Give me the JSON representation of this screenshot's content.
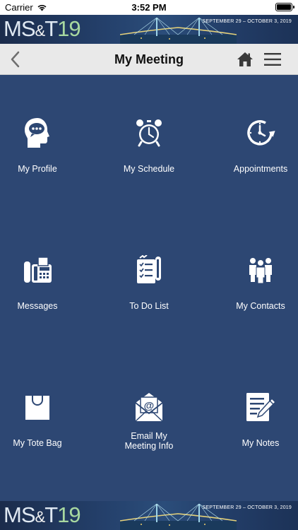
{
  "status_bar": {
    "carrier": "Carrier",
    "time": "3:52 PM"
  },
  "banner": {
    "title_ms": "MS",
    "title_amp": "&",
    "title_t": "T",
    "title_num": "19",
    "dates": "SEPTEMBER 29 – OCTOBER 3, 2019"
  },
  "navbar": {
    "title": "My Meeting",
    "back_icon": "chevron-left-icon",
    "home_icon": "home-icon",
    "menu_icon": "hamburger-menu-icon"
  },
  "tiles": [
    {
      "label": "My Profile",
      "icon": "profile-head-icon"
    },
    {
      "label": "My Schedule",
      "icon": "alarm-clock-icon"
    },
    {
      "label": "Appointments",
      "icon": "clock-arrow-icon"
    },
    {
      "label": "Messages",
      "icon": "fax-phone-icon"
    },
    {
      "label": "To Do List",
      "icon": "checklist-icon"
    },
    {
      "label": "My Contacts",
      "icon": "people-group-icon"
    },
    {
      "label": "My Tote Bag",
      "icon": "tote-bag-icon"
    },
    {
      "label": "Email My Meeting Info",
      "icon": "email-at-icon"
    },
    {
      "label": "My Notes",
      "icon": "notepad-pencil-icon"
    }
  ],
  "colors": {
    "background": "#2d4773",
    "navbar": "#e9e9e9",
    "tile_text": "#ffffff"
  }
}
